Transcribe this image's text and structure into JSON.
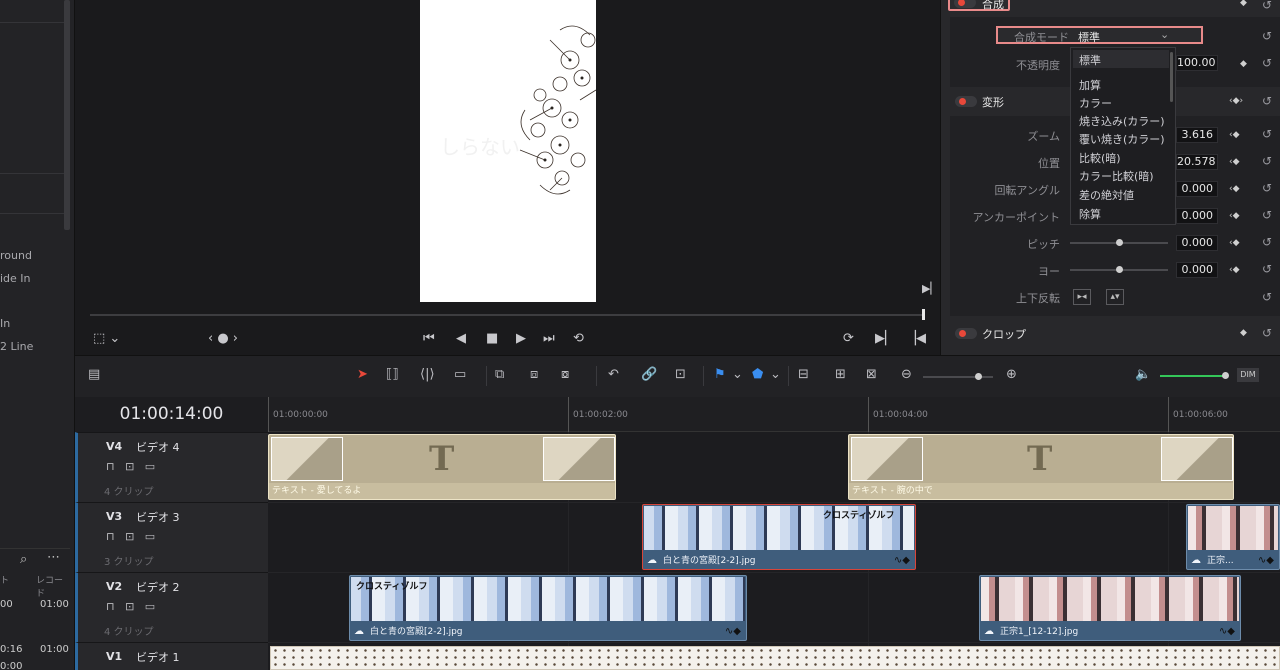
{
  "left_bin": {
    "items": [
      "round",
      "ide In",
      "In",
      "2 Line"
    ],
    "lower_values": [
      "00",
      "01:00",
      "0:16",
      "01:00",
      "0:00"
    ],
    "lower_headers": [
      "ト",
      "レコード"
    ]
  },
  "viewer": {
    "watermark": "しらない"
  },
  "inspector": {
    "composite": {
      "title": "合成",
      "mode_label": "合成モード",
      "mode_value": "標準",
      "opacity_label": "不透明度",
      "opacity_value": "100.00"
    },
    "blend_options": [
      "標準",
      "加算",
      "カラー",
      "焼き込み(カラー)",
      "覆い焼き(カラー)",
      "比較(暗)",
      "カラー比較(暗)",
      "差の絶対値",
      "除算"
    ],
    "transform": {
      "title": "変形",
      "rows": [
        {
          "label": "ズーム",
          "value": "3.616"
        },
        {
          "label": "位置",
          "value": "20.578"
        },
        {
          "label": "回転アングル",
          "value": "0.000"
        },
        {
          "label": "アンカーポイント",
          "value": "0.000"
        },
        {
          "label": "ピッチ",
          "value": "0.000"
        },
        {
          "label": "ヨー",
          "value": "0.000"
        }
      ],
      "flip_label": "上下反転"
    },
    "crop": {
      "title": "クロップ"
    }
  },
  "timeline": {
    "timecode": "01:00:14:00",
    "ruler": [
      "01:00:00:00",
      "01:00:02:00",
      "01:00:04:00",
      "01:00:06:00"
    ],
    "audio_dim": "DIM",
    "tracks": [
      {
        "id": "V4",
        "name": "ビデオ 4",
        "count": "4 クリップ"
      },
      {
        "id": "V3",
        "name": "ビデオ 3",
        "count": "3 クリップ"
      },
      {
        "id": "V2",
        "name": "ビデオ 2",
        "count": "4 クリップ"
      },
      {
        "id": "V1",
        "name": "ビデオ 1"
      }
    ],
    "clips": {
      "v4a": "テキスト - 愛してるよ",
      "v4b": "テキスト - 腕の中で",
      "v3a": "白と青の宮殿[2-2].jpg",
      "v3b": "正宗...",
      "v2a": "白と青の宮殿[2-2].jpg",
      "v2b": "正宗1_[12-12].jpg"
    },
    "thumb_text": "クロスティゾルフ"
  },
  "icons": {
    "accent": "#e8483a",
    "track_accent": "#2d6aa0",
    "clip_blue": "#3f5d7c",
    "clip_title": "#b9ae92"
  }
}
